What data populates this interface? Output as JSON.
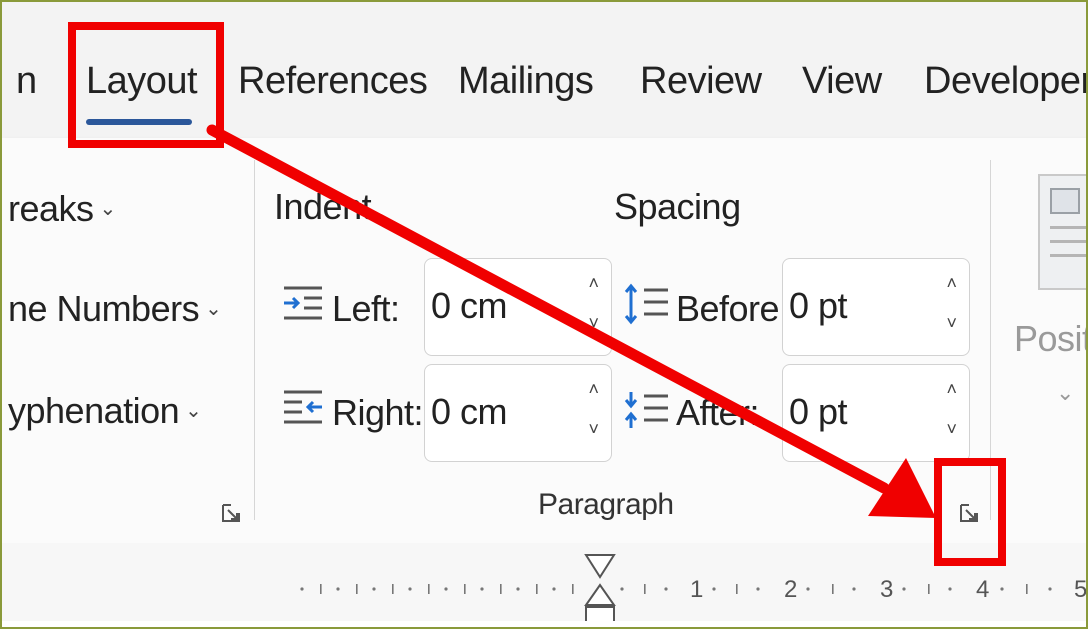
{
  "tabs": {
    "cut": "n",
    "layout": "Layout",
    "references": "References",
    "mailings": "Mailings",
    "review": "Review",
    "view": "View",
    "developer": "Developer"
  },
  "page_setup": {
    "breaks": "reaks",
    "line_numbers": "ne Numbers",
    "hyphenation": "yphenation"
  },
  "paragraph": {
    "group_label": "Paragraph",
    "indent_header": "Indent",
    "spacing_header": "Spacing",
    "left_label": "Left:",
    "left_value": "0 cm",
    "right_label": "Right:",
    "right_value": "0 cm",
    "before_label": "Before:",
    "before_value": "0 pt",
    "after_label": "After:",
    "after_value": "0 pt"
  },
  "arrange": {
    "position_label": "Positio"
  },
  "ruler": {
    "marks": [
      "1",
      "2",
      "3",
      "4",
      "5"
    ]
  },
  "icons": {
    "dropdown": "chevron-down-icon",
    "launcher": "dialog-launcher-icon",
    "indent_left": "indent-left-icon",
    "indent_right": "indent-right-icon",
    "spacing_before": "spacing-before-icon",
    "spacing_after": "spacing-after-icon"
  },
  "colors": {
    "annotation": "#f00000",
    "tab_underline": "#2b579a"
  }
}
